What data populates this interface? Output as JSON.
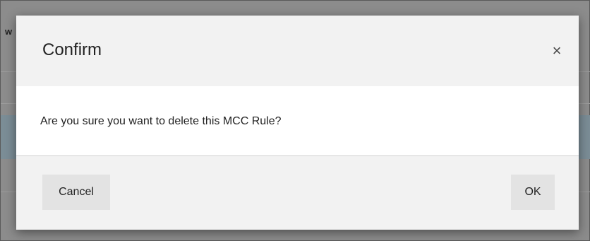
{
  "background": {
    "partial_text": "w"
  },
  "dialog": {
    "title": "Confirm",
    "close_glyph": "×",
    "message": "Are you sure you want to delete this MCC Rule?",
    "buttons": {
      "cancel_label": "Cancel",
      "ok_label": "OK"
    }
  },
  "colors": {
    "overlay": "#8c8c8c",
    "dialog_header_bg": "#f2f2f2",
    "dialog_body_bg": "#ffffff",
    "button_bg": "#e3e3e3"
  },
  "icons": {
    "close": "close-icon"
  }
}
